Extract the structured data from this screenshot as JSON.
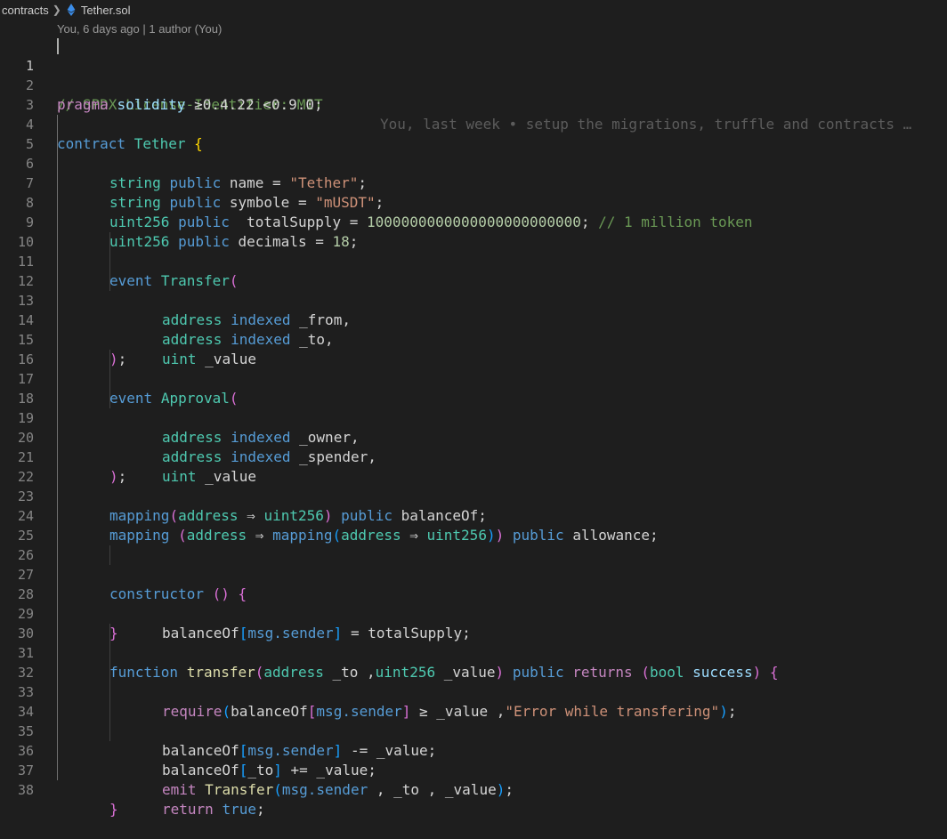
{
  "breadcrumb": {
    "folder": "contracts",
    "file": "Tether.sol"
  },
  "blame": "You, 6 days ago | 1 author (You)",
  "ghost_blame": "You, last week • setup the migrations, truffle and contracts …",
  "colors": {
    "background": "#1e1e1e",
    "keyword": "#c586c0",
    "type": "#4ec9b0",
    "storage": "#569cd6",
    "function": "#dcdcaa",
    "string": "#ce9178",
    "number": "#b5cea8",
    "comment": "#6a9955",
    "bracket1": "#ffd700",
    "bracket2": "#da70d6",
    "bracket3": "#179fff",
    "ethereum": "#3b8eea"
  },
  "active_line": 1,
  "lines": [
    {
      "n": "1",
      "code": "// SPDX-License-Identifier: MIT"
    },
    {
      "n": "2",
      "code": "pragma solidity ≥0.4.22 <0.9.0;"
    },
    {
      "n": "3",
      "code": ""
    },
    {
      "n": "4",
      "code": "contract Tether {"
    },
    {
      "n": "5",
      "code": "string public name = \"Tether\";"
    },
    {
      "n": "6",
      "code": "string public symbole = \"mUSDT\";"
    },
    {
      "n": "7",
      "code": "uint256 public  totalSupply = 1000000000000000000000000; // 1 million token"
    },
    {
      "n": "8",
      "code": "uint256 public decimals = 18;"
    },
    {
      "n": "9",
      "code": ""
    },
    {
      "n": "10",
      "code": "event Transfer("
    },
    {
      "n": "11",
      "code": "address indexed _from,"
    },
    {
      "n": "12",
      "code": "address indexed _to,"
    },
    {
      "n": "13",
      "code": "uint _value"
    },
    {
      "n": "14",
      "code": ");"
    },
    {
      "n": "15",
      "code": ""
    },
    {
      "n": "16",
      "code": "event Approval("
    },
    {
      "n": "17",
      "code": "address indexed _owner,"
    },
    {
      "n": "18",
      "code": "address indexed _spender,"
    },
    {
      "n": "19",
      "code": "uint _value"
    },
    {
      "n": "20",
      "code": ");"
    },
    {
      "n": "21",
      "code": ""
    },
    {
      "n": "22",
      "code": "mapping(address ⇒ uint256) public balanceOf;"
    },
    {
      "n": "23",
      "code": "mapping (address ⇒ mapping(address ⇒ uint256)) public allowance;"
    },
    {
      "n": "24",
      "code": ""
    },
    {
      "n": "25",
      "code": ""
    },
    {
      "n": "26",
      "code": "constructor () {"
    },
    {
      "n": "27",
      "code": "balanceOf[msg.sender] = totalSupply;"
    },
    {
      "n": "28",
      "code": "}"
    },
    {
      "n": "29",
      "code": ""
    },
    {
      "n": "30",
      "code": "function transfer(address _to ,uint256 _value) public returns (bool success) {"
    },
    {
      "n": "31",
      "code": "require(balanceOf[msg.sender] ≥ _value ,\"Error while transfering\");"
    },
    {
      "n": "32",
      "code": ""
    },
    {
      "n": "33",
      "code": "balanceOf[msg.sender] -= _value;"
    },
    {
      "n": "34",
      "code": "balanceOf[_to] += _value;"
    },
    {
      "n": "35",
      "code": "emit Transfer(msg.sender , _to , _value);"
    },
    {
      "n": "36",
      "code": "return true;"
    },
    {
      "n": "37",
      "code": "}"
    },
    {
      "n": "38",
      "code": ""
    }
  ]
}
